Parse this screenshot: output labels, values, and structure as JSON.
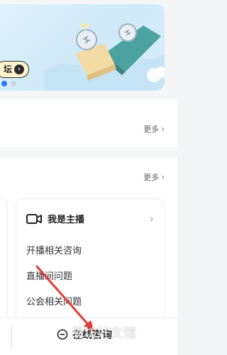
{
  "banner": {
    "tag_label": "坛"
  },
  "section1": {
    "more_label": "更多"
  },
  "section2": {
    "more_label": "更多",
    "card": {
      "title": "我是主播",
      "items": [
        "开播相关咨询",
        "直播间问题",
        "公会相关问题"
      ]
    }
  },
  "bottom": {
    "consult_label": "在线咨询"
  },
  "watermark": "易坊好文馆",
  "colors": {
    "accent": "#2a7bff",
    "arrow": "#e23b3b"
  }
}
